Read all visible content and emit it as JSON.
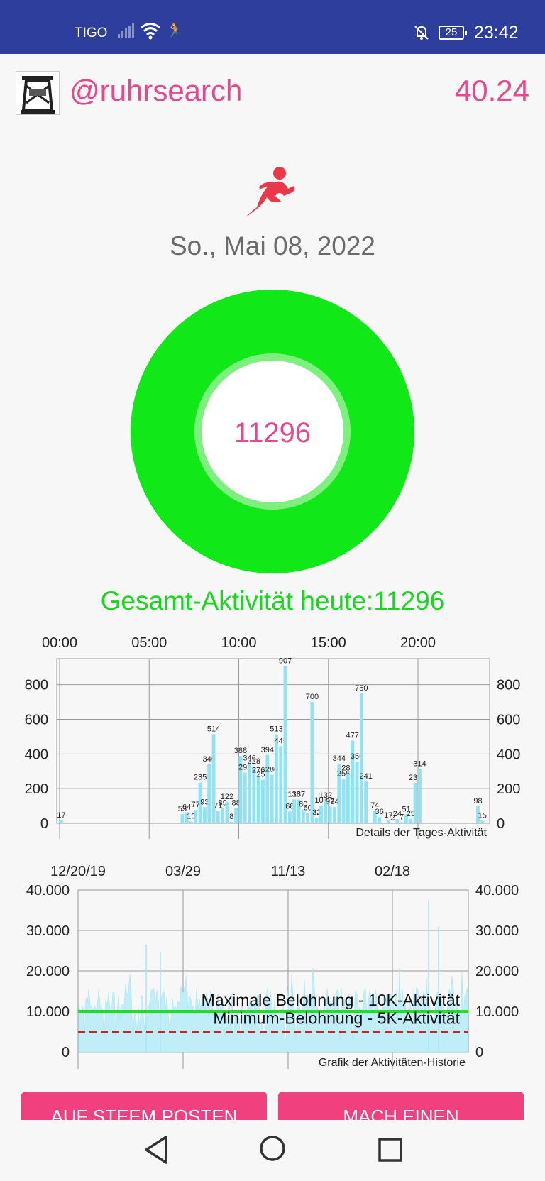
{
  "status_bar": {
    "carrier": "TIGO",
    "battery": "25",
    "time": "23:42",
    "background": "#2e3e9c"
  },
  "header": {
    "username": "@ruhrsearch",
    "balance": "40.24"
  },
  "date": "So., Mai 08, 2022",
  "steps_ring": {
    "value": "11296",
    "ring_color": "#11e817"
  },
  "total_label": "Gesamt-Aktivität heute:11296",
  "chart_data": [
    {
      "type": "bar",
      "title": "Details der Tages-Aktivität",
      "x_tick_labels": [
        "00:00",
        "05:00",
        "10:00",
        "15:00",
        "20:00"
      ],
      "y_ticks": [
        0,
        200,
        400,
        600,
        800
      ],
      "ylim": [
        0,
        950
      ],
      "xlim_hours": [
        0,
        24
      ],
      "grid": true,
      "bar_color": "#8ee3f5",
      "bars": [
        {
          "hour": 0.0,
          "value": 17
        },
        {
          "hour": 6.75,
          "value": 53
        },
        {
          "hour": 7.0,
          "value": 64
        },
        {
          "hour": 7.25,
          "value": 10
        },
        {
          "hour": 7.5,
          "value": 77
        },
        {
          "hour": 7.75,
          "value": 235
        },
        {
          "hour": 8.0,
          "value": 93
        },
        {
          "hour": 8.25,
          "value": 340
        },
        {
          "hour": 8.5,
          "value": 514
        },
        {
          "hour": 8.75,
          "value": 71
        },
        {
          "hour": 9.0,
          "value": 89
        },
        {
          "hour": 9.25,
          "value": 122
        },
        {
          "hour": 9.5,
          "value": 8
        },
        {
          "hour": 9.75,
          "value": 88
        },
        {
          "hour": 10.0,
          "value": 388
        },
        {
          "hour": 10.25,
          "value": 292
        },
        {
          "hour": 10.5,
          "value": 346
        },
        {
          "hour": 10.75,
          "value": 328
        },
        {
          "hour": 11.0,
          "value": 276
        },
        {
          "hour": 11.25,
          "value": 251
        },
        {
          "hour": 11.5,
          "value": 394
        },
        {
          "hour": 11.75,
          "value": 280
        },
        {
          "hour": 12.0,
          "value": 513
        },
        {
          "hour": 12.25,
          "value": 445
        },
        {
          "hour": 12.5,
          "value": 907
        },
        {
          "hour": 12.75,
          "value": 68
        },
        {
          "hour": 13.0,
          "value": 138
        },
        {
          "hour": 13.25,
          "value": 137
        },
        {
          "hour": 13.5,
          "value": 80
        },
        {
          "hour": 13.75,
          "value": 60
        },
        {
          "hour": 14.0,
          "value": 700
        },
        {
          "hour": 14.25,
          "value": 32
        },
        {
          "hour": 14.5,
          "value": 103
        },
        {
          "hour": 14.75,
          "value": 132
        },
        {
          "hour": 15.0,
          "value": 97
        },
        {
          "hour": 15.25,
          "value": 94
        },
        {
          "hour": 15.5,
          "value": 344
        },
        {
          "hour": 15.75,
          "value": 256
        },
        {
          "hour": 16.0,
          "value": 288
        },
        {
          "hour": 16.25,
          "value": 477
        },
        {
          "hour": 16.5,
          "value": 356
        },
        {
          "hour": 16.75,
          "value": 750
        },
        {
          "hour": 17.0,
          "value": 241
        },
        {
          "hour": 17.5,
          "value": 74
        },
        {
          "hour": 17.75,
          "value": 36
        },
        {
          "hour": 18.25,
          "value": 17
        },
        {
          "hour": 18.5,
          "value": 2
        },
        {
          "hour": 18.75,
          "value": 24
        },
        {
          "hour": 19.0,
          "value": 7
        },
        {
          "hour": 19.25,
          "value": 51
        },
        {
          "hour": 19.5,
          "value": 25
        },
        {
          "hour": 19.75,
          "value": 233
        },
        {
          "hour": 20.0,
          "value": 314
        },
        {
          "hour": 23.25,
          "value": 98
        },
        {
          "hour": 23.5,
          "value": 15
        }
      ]
    },
    {
      "type": "area",
      "title": "Grafik der Aktivitäten-Historie",
      "x_tick_labels": [
        "12/20/19",
        "03/29",
        "11/13",
        "02/18"
      ],
      "y_tick_labels": [
        "0",
        "10.000",
        "20.000",
        "30.000",
        "40.000"
      ],
      "y_ticks": [
        0,
        10000,
        20000,
        30000,
        40000
      ],
      "ylim": [
        0,
        40000
      ],
      "grid": true,
      "series_color": "#bfeef8",
      "reference_lines": [
        {
          "name": "Maximale Belohnung - 10K-Aktivität",
          "value": 10000,
          "color": "#22dd22",
          "style": "solid"
        },
        {
          "name": "Minimum-Belohnung - 5K-Aktivität",
          "value": 5000,
          "color": "#cc2222",
          "style": "dashed"
        }
      ],
      "notable_peaks": [
        26500,
        24500,
        37500,
        31000
      ]
    }
  ],
  "buttons": {
    "post": "AUF STEEM POSTEN",
    "make": "MACH EINEN"
  }
}
